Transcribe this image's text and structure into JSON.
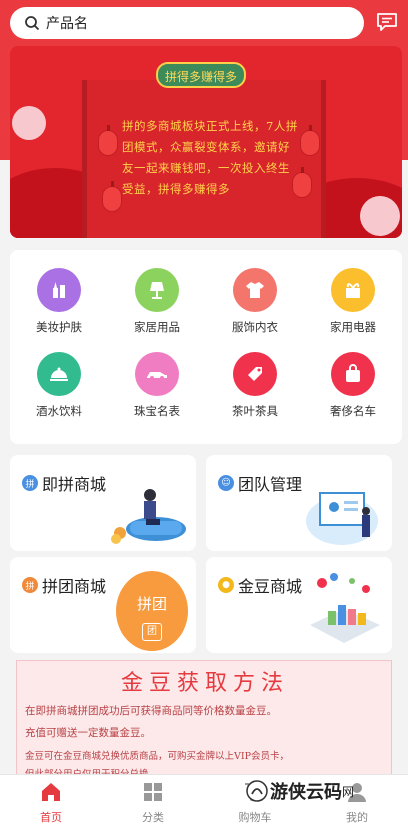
{
  "search": {
    "placeholder": "产品名"
  },
  "banner": {
    "title": "拼得多赚得多",
    "text": "拼的多商城板块正式上线，7人拼团模式，众赢裂变体系，邀请好友一起来赚钱吧，一次投入终生受益，拼得多赚得多"
  },
  "categories": [
    {
      "label": "美妆护肤",
      "icon": "lipstick-icon",
      "color": "#a971e4"
    },
    {
      "label": "家居用品",
      "icon": "lamp-icon",
      "color": "#8bd35e"
    },
    {
      "label": "服饰内衣",
      "icon": "shirt-icon",
      "color": "#f3756c"
    },
    {
      "label": "家用电器",
      "icon": "appliance-icon",
      "color": "#fbbe2c"
    },
    {
      "label": "酒水饮料",
      "icon": "cloche-icon",
      "color": "#31bb8e"
    },
    {
      "label": "珠宝名表",
      "icon": "car-icon",
      "color": "#f07cc1"
    },
    {
      "label": "茶叶茶具",
      "icon": "tag-icon",
      "color": "#f0324d"
    },
    {
      "label": "奢侈名车",
      "icon": "bag-icon",
      "color": "#f0324d"
    }
  ],
  "cards": {
    "jipin": {
      "title": "即拼商城",
      "badge": "拼"
    },
    "team": {
      "title": "团队管理",
      "badge": "☺"
    },
    "pintuan": {
      "title": "拼团商城",
      "badge": "拼",
      "bag_label": "拼团",
      "bag_sub": "团"
    },
    "jindou": {
      "title": "金豆商城",
      "badge": "●"
    }
  },
  "notice": {
    "title": "金豆获取方法",
    "line1": "在即拼商城拼团成功后可获得商品同等价格数量金豆。",
    "line2": "充值可赠送一定数量金豆。",
    "line3": "金豆可在金豆商城兑换优质商品，可购买金牌以上VIP会员卡，",
    "line4": "但此部分用户仅用于积分兑换。"
  },
  "tabs": [
    {
      "label": "首页",
      "active": true
    },
    {
      "label": "分类",
      "active": false
    },
    {
      "label": "购物车",
      "active": false
    },
    {
      "label": "我的",
      "active": false
    }
  ],
  "watermark": {
    "text": "游侠云码",
    "suffix": "网"
  },
  "colors": {
    "brand": "#ea3a3f",
    "active_tab": "#e53a3f"
  }
}
